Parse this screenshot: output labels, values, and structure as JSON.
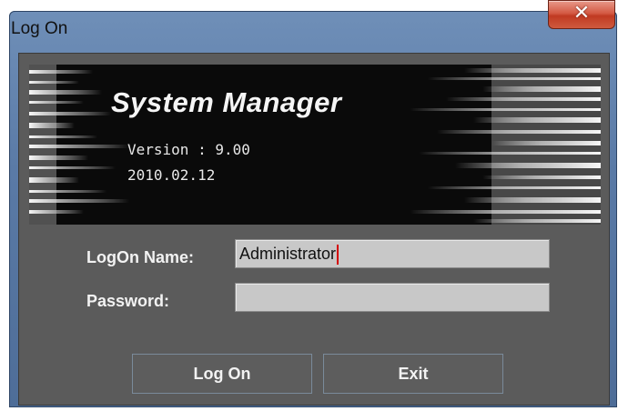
{
  "window": {
    "title": "Log On"
  },
  "banner": {
    "app_title": "System Manager",
    "version": "Version : 9.00",
    "date": "2010.02.12"
  },
  "form": {
    "logon_name_label": "LogOn Name:",
    "logon_name_value": "Administrator",
    "password_label": "Password:",
    "password_value": ""
  },
  "buttons": {
    "logon": "Log On",
    "exit": "Exit"
  },
  "colors": {
    "dialog_bg": "#5b5b5b",
    "field_bg": "#c8c8c8",
    "close_red": "#c03a22",
    "caret": "#d40000"
  },
  "icons": {
    "close": "close-icon"
  }
}
